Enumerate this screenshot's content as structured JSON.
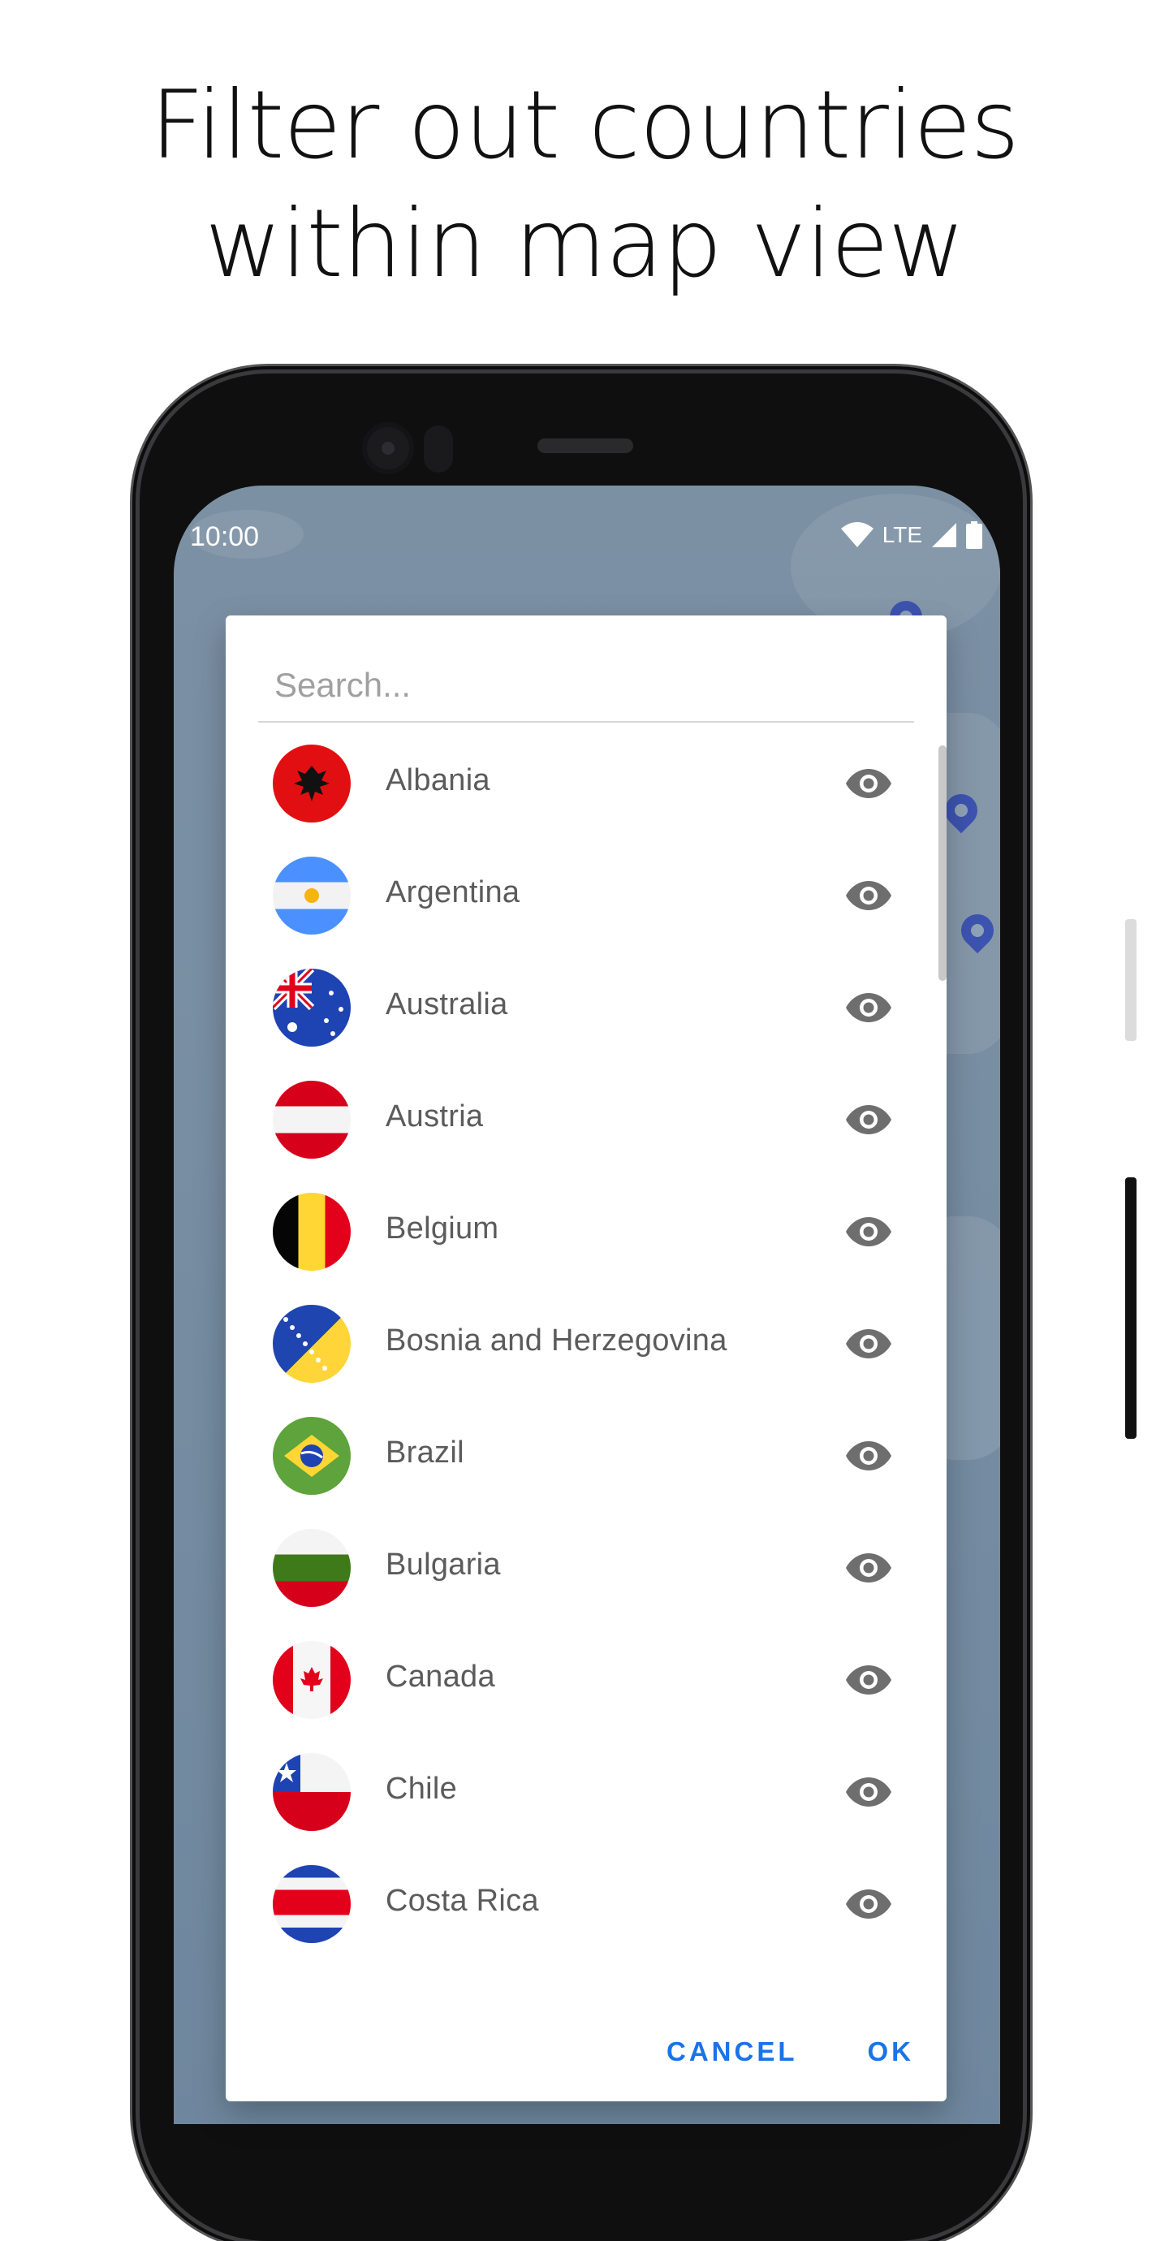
{
  "headline": {
    "line1": "Filter out countries",
    "line2": "within map view"
  },
  "status_bar": {
    "time": "10:00",
    "network": "LTE",
    "icons": [
      "wifi-icon",
      "signal-icon",
      "battery-icon"
    ]
  },
  "dialog": {
    "search_placeholder": "Search...",
    "countries": [
      {
        "name": "Albania",
        "flag": "albania-flag-icon",
        "visibility_icon": "eye-icon"
      },
      {
        "name": "Argentina",
        "flag": "argentina-flag-icon",
        "visibility_icon": "eye-icon"
      },
      {
        "name": "Australia",
        "flag": "australia-flag-icon",
        "visibility_icon": "eye-icon"
      },
      {
        "name": "Austria",
        "flag": "austria-flag-icon",
        "visibility_icon": "eye-icon"
      },
      {
        "name": "Belgium",
        "flag": "belgium-flag-icon",
        "visibility_icon": "eye-icon"
      },
      {
        "name": "Bosnia and Herzegovina",
        "flag": "bosnia-flag-icon",
        "visibility_icon": "eye-icon"
      },
      {
        "name": "Brazil",
        "flag": "brazil-flag-icon",
        "visibility_icon": "eye-icon"
      },
      {
        "name": "Bulgaria",
        "flag": "bulgaria-flag-icon",
        "visibility_icon": "eye-icon"
      },
      {
        "name": "Canada",
        "flag": "canada-flag-icon",
        "visibility_icon": "eye-icon"
      },
      {
        "name": "Chile",
        "flag": "chile-flag-icon",
        "visibility_icon": "eye-icon"
      },
      {
        "name": "Costa Rica",
        "flag": "costa-rica-flag-icon",
        "visibility_icon": "eye-icon"
      }
    ],
    "cancel_label": "CANCEL",
    "ok_label": "OK"
  },
  "colors": {
    "accent": "#1a73e8",
    "map": "#8fa3b6",
    "pin": "#3d53b0",
    "eye": "#6e6e6e"
  }
}
